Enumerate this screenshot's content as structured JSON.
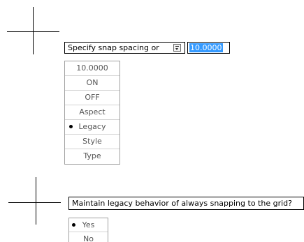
{
  "snap_prompt": {
    "text": "Specify snap spacing or",
    "dropdown_icon": "dropdown-arrow-icon",
    "value": "10.0000",
    "options": [
      {
        "label": "10.0000",
        "selected": false
      },
      {
        "label": "ON",
        "selected": false
      },
      {
        "label": "OFF",
        "selected": false
      },
      {
        "label": "Aspect",
        "selected": false
      },
      {
        "label": "Legacy",
        "selected": true
      },
      {
        "label": "Style",
        "selected": false
      },
      {
        "label": "Type",
        "selected": false
      }
    ]
  },
  "legacy_prompt": {
    "text": "Maintain legacy behavior of always snapping to the grid?",
    "options": [
      {
        "label": "Yes",
        "selected": true
      },
      {
        "label": "No",
        "selected": false
      }
    ]
  }
}
